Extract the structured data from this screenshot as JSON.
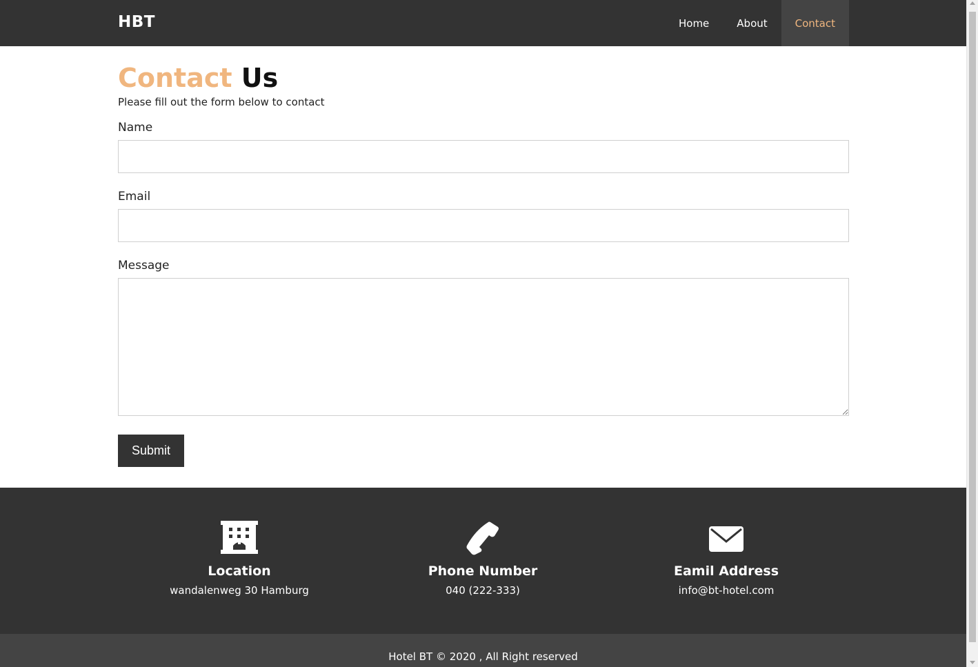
{
  "navbar": {
    "brand": "HBT",
    "items": [
      {
        "label": "Home",
        "active": false
      },
      {
        "label": "About",
        "active": false
      },
      {
        "label": "Contact",
        "active": true
      }
    ],
    "accent_color": "#f0b67f",
    "background_color": "#333333"
  },
  "main": {
    "title_accent": "Contact",
    "title_rest": "Us",
    "subtitle": "Please fill out the form below to contact",
    "form": {
      "name_label": "Name",
      "name_value": "",
      "email_label": "Email",
      "email_value": "",
      "message_label": "Message",
      "message_value": "",
      "submit_label": "Submit"
    }
  },
  "footer": {
    "columns": [
      {
        "icon": "building-icon",
        "title": "Location",
        "value": "wandalenweg 30 Hamburg"
      },
      {
        "icon": "phone-icon",
        "title": "Phone Number",
        "value": "040 (222-333)"
      },
      {
        "icon": "envelope-icon",
        "title": "Eamil Address",
        "value": "info@bt-hotel.com"
      }
    ],
    "copyright": "Hotel BT © 2020 , All Right reserved"
  }
}
